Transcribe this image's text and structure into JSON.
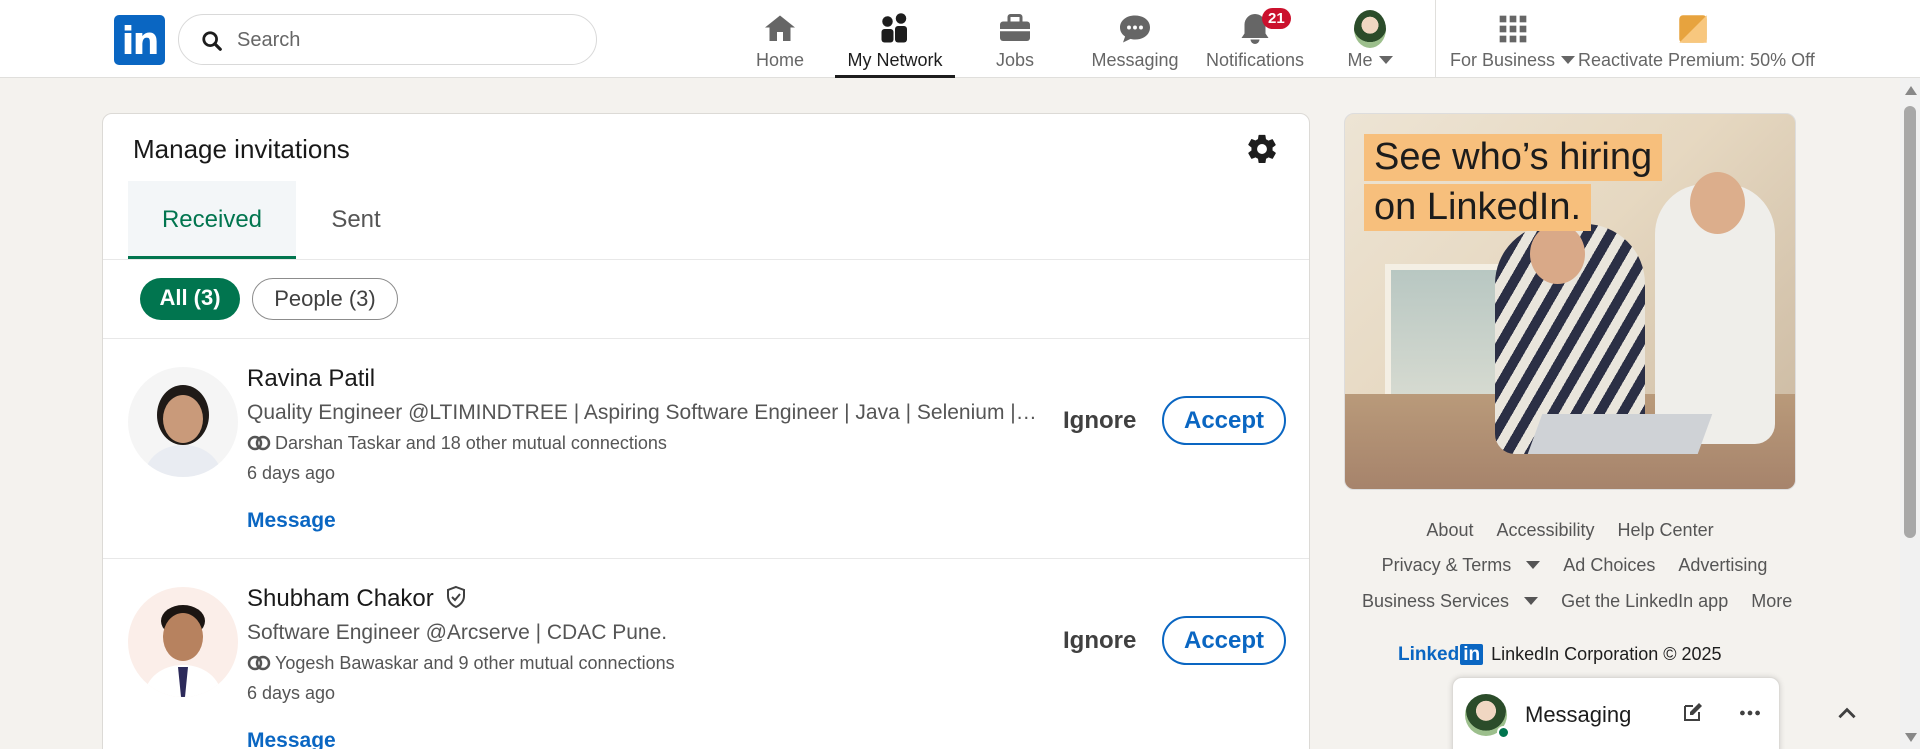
{
  "nav": {
    "logo": "in",
    "search_placeholder": "Search",
    "items": [
      {
        "label": "Home",
        "icon": "home-icon"
      },
      {
        "label": "My Network",
        "icon": "network-icon"
      },
      {
        "label": "Jobs",
        "icon": "briefcase-icon"
      },
      {
        "label": "Messaging",
        "icon": "chat-icon"
      },
      {
        "label": "Notifications",
        "icon": "bell-icon",
        "badge": "21"
      },
      {
        "label": "Me",
        "icon": "avatar"
      },
      {
        "label": "For Business",
        "icon": "grid-icon"
      },
      {
        "label": "Reactivate Premium: 50% Off",
        "icon": "premium-icon"
      }
    ],
    "active": "My Network"
  },
  "invitations": {
    "title": "Manage invitations",
    "tabs": [
      "Received",
      "Sent"
    ],
    "active_tab": "Received",
    "filters": [
      "All (3)",
      "People (3)"
    ],
    "active_filter": "All (3)",
    "rows": [
      {
        "name": "Ravina Patil",
        "verified": false,
        "headline": "Quality Engineer @LTIMINDTREE | Aspiring Software Engineer | Java | Selenium | BD...",
        "mutual": "Darshan Taskar and 18 other mutual connections",
        "time": "6 days ago",
        "message": "Message",
        "ignore": "Ignore",
        "accept": "Accept"
      },
      {
        "name": "Shubham Chakor",
        "verified": true,
        "headline": "Software Engineer @Arcserve | CDAC Pune.",
        "mutual": "Yogesh Bawaskar and 9 other mutual connections",
        "time": "6 days ago",
        "message": "Message",
        "ignore": "Ignore",
        "accept": "Accept"
      }
    ]
  },
  "ad": {
    "line1": "See who’s hiring",
    "line2": "on LinkedIn."
  },
  "footer": {
    "row1": [
      "About",
      "Accessibility",
      "Help Center"
    ],
    "row2": [
      "Privacy & Terms",
      "Ad Choices",
      "Advertising"
    ],
    "row3": [
      "Business Services",
      "Get the LinkedIn app",
      "More"
    ],
    "brand": "Linked",
    "brand_in": "in",
    "copyright": "LinkedIn Corporation © 2025"
  },
  "messaging": {
    "title": "Messaging"
  },
  "colors": {
    "brand": "#0a66c2",
    "green": "#01754f",
    "badge": "#cb112d"
  }
}
